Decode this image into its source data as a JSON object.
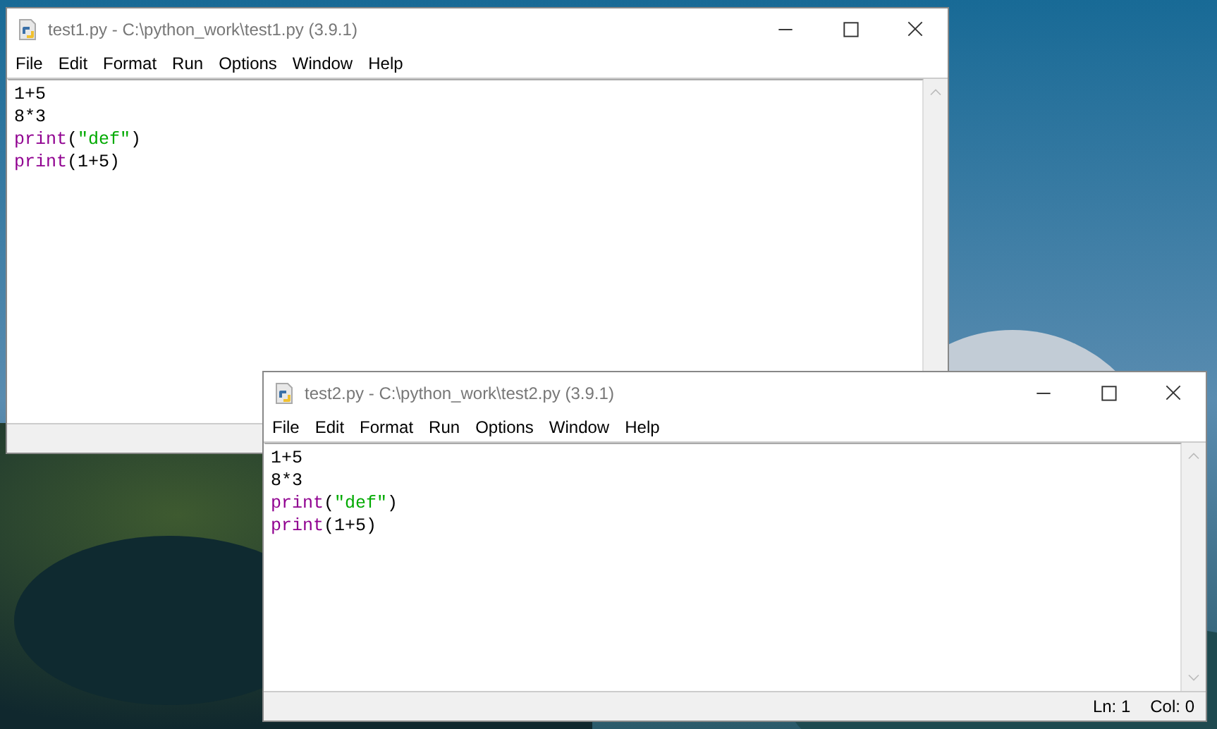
{
  "windows": [
    {
      "title": "test1.py - C:\\python_work\\test1.py (3.9.1)",
      "menu": [
        "File",
        "Edit",
        "Format",
        "Run",
        "Options",
        "Window",
        "Help"
      ],
      "code": [
        [
          {
            "text": "1+5",
            "kind": "plain"
          }
        ],
        [
          {
            "text": "8*3",
            "kind": "plain"
          }
        ],
        [
          {
            "text": "print",
            "kind": "builtin"
          },
          {
            "text": "(",
            "kind": "plain"
          },
          {
            "text": "\"def\"",
            "kind": "string"
          },
          {
            "text": ")",
            "kind": "plain"
          }
        ],
        [
          {
            "text": "print",
            "kind": "builtin"
          },
          {
            "text": "(1+5)",
            "kind": "plain"
          }
        ]
      ]
    },
    {
      "title": "test2.py - C:\\python_work\\test2.py (3.9.1)",
      "menu": [
        "File",
        "Edit",
        "Format",
        "Run",
        "Options",
        "Window",
        "Help"
      ],
      "code": [
        [
          {
            "text": "1+5",
            "kind": "plain"
          }
        ],
        [
          {
            "text": "8*3",
            "kind": "plain"
          }
        ],
        [
          {
            "text": "print",
            "kind": "builtin"
          },
          {
            "text": "(",
            "kind": "plain"
          },
          {
            "text": "\"def\"",
            "kind": "string"
          },
          {
            "text": ")",
            "kind": "plain"
          }
        ],
        [
          {
            "text": "print",
            "kind": "builtin"
          },
          {
            "text": "(1+5)",
            "kind": "plain"
          }
        ]
      ],
      "status": {
        "line": "Ln: 1",
        "col": "Col: 0"
      }
    }
  ]
}
